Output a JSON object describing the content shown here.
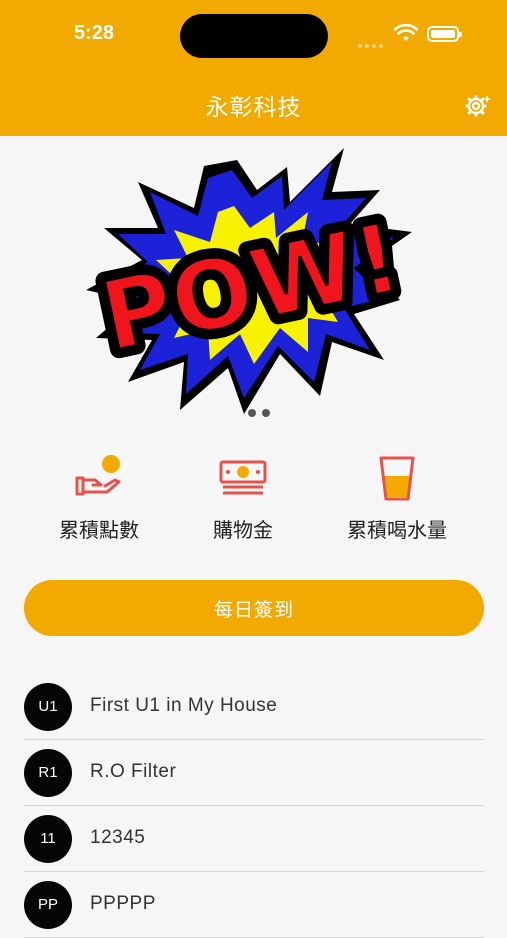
{
  "status_bar": {
    "time": "5:28"
  },
  "nav": {
    "title": "永彰科技",
    "settings_icon": "settings-gear-icon"
  },
  "banner": {
    "text": "POW!",
    "pages": 2
  },
  "quick_actions": [
    {
      "label": "累積點數",
      "icon": "coin-hand-icon"
    },
    {
      "label": "購物金",
      "icon": "cash-stack-icon"
    },
    {
      "label": "累積喝水量",
      "icon": "water-glass-icon"
    }
  ],
  "checkin": {
    "label": "每日簽到"
  },
  "devices": [
    {
      "code": "U1",
      "name": "First U1 in My House"
    },
    {
      "code": "R1",
      "name": "R.O Filter"
    },
    {
      "code": "11",
      "name": "12345"
    },
    {
      "code": "PP",
      "name": "PPPPP"
    }
  ],
  "colors": {
    "accent": "#f3aa00",
    "icon_red": "#e8514a"
  }
}
